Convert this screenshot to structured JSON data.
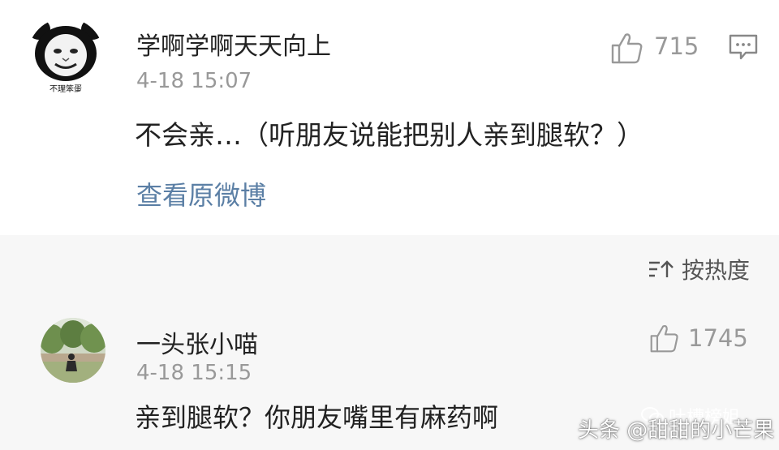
{
  "post": {
    "username": "学啊学啊天天向上",
    "avatar_caption": "不理笨蛋",
    "time": "4-18 15:07",
    "likes": "715",
    "content": "不会亲…（听朋友说能把别人亲到腿软？）",
    "view_original": "查看原微博"
  },
  "sort": {
    "label": "按热度"
  },
  "comment": {
    "username": "一头张小喵",
    "time": "4-18 15:15",
    "likes": "1745",
    "content": "亲到腿软？你朋友嘴里有麻药啊"
  },
  "watermarks": {
    "wechat": "吐槽榜姐",
    "toutiao": "头条 @甜甜的小芒果"
  },
  "colors": {
    "link": "#5b7fa5",
    "muted": "#999999",
    "comment_bg": "#f7f7f7"
  },
  "icons": [
    "thumbs-up-icon",
    "reply-icon",
    "sort-icon",
    "wechat-icon"
  ]
}
